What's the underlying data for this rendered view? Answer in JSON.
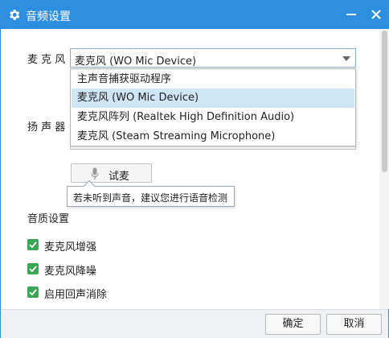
{
  "window": {
    "title": "音频设置"
  },
  "mic": {
    "label": "麦 克 风",
    "selected": "麦克风 (WO Mic Device)",
    "options": [
      "主声音捕获驱动程序",
      "麦克风 (WO Mic Device)",
      "麦克风阵列 (Realtek High Definition Audio)",
      "麦克风 (Steam Streaming Microphone)"
    ],
    "highlighted_index": 1
  },
  "speaker": {
    "label": "扬 声 器"
  },
  "test": {
    "button_label": "试麦",
    "tooltip": "若未听到声音，建议您进行语音检测"
  },
  "quality": {
    "heading": "音质设置",
    "options": [
      {
        "label": "麦克风增强",
        "checked": true
      },
      {
        "label": "麦克风降噪",
        "checked": true
      },
      {
        "label": "启用回声消除",
        "checked": true
      }
    ]
  },
  "footer": {
    "ok_label": "确定",
    "cancel_label": "取消"
  },
  "colors": {
    "titlebar": "#2e8ee0",
    "checkbox": "#3aa757",
    "selection": "#cfe6f7"
  },
  "icons": {
    "app": "gear-icon",
    "minimize": "minimize-icon",
    "close": "close-icon",
    "mic": "microphone-icon"
  }
}
